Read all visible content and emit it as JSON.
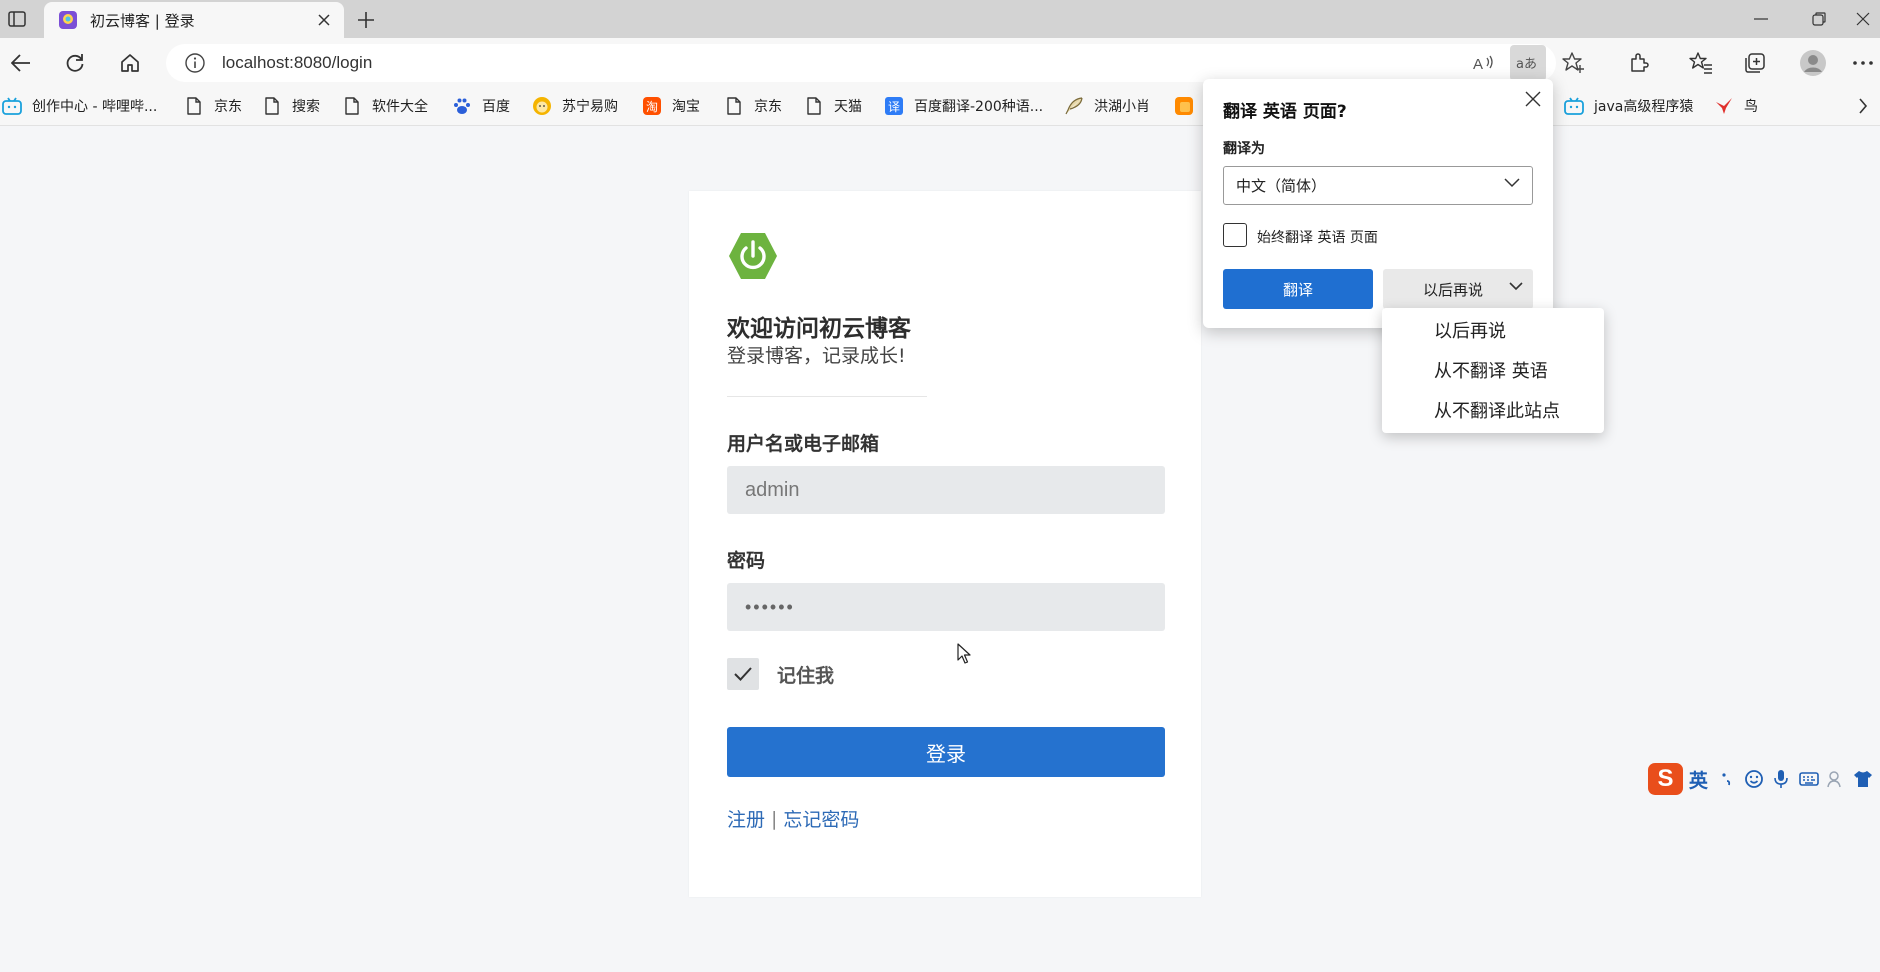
{
  "browser": {
    "tab_title": "初云博客 | 登录",
    "url": "localhost:8080/login",
    "favorites": [
      {
        "label": "创作中心 - 哔哩哔...",
        "icon": "bilibili-icon"
      },
      {
        "label": "京东",
        "icon": "page-icon"
      },
      {
        "label": "搜索",
        "icon": "page-icon"
      },
      {
        "label": "软件大全",
        "icon": "page-icon"
      },
      {
        "label": "百度",
        "icon": "baidu-paw-icon"
      },
      {
        "label": "苏宁易购",
        "icon": "suning-lion-icon"
      },
      {
        "label": "淘宝",
        "icon": "taobao-icon"
      },
      {
        "label": "京东",
        "icon": "page-icon"
      },
      {
        "label": "天猫",
        "icon": "page-icon"
      },
      {
        "label": "百度翻译-200种语...",
        "icon": "baidu-translate-icon"
      },
      {
        "label": "洪湖小肖",
        "icon": "feather-icon"
      },
      {
        "label": "java高级程序猿",
        "icon": "bilibili-icon"
      },
      {
        "label": "鸟",
        "icon": "bird-icon"
      }
    ]
  },
  "login": {
    "heading": "欢迎访问初云博客",
    "subheading": "登录博客，记录成长!",
    "username_label": "用户名或电子邮箱",
    "username_value": "admin",
    "password_label": "密码",
    "password_value": "••••••",
    "remember_label": "记住我",
    "remember_checked": true,
    "submit_label": "登录",
    "register_link": "注册",
    "link_separator": "|",
    "forgot_link": "忘记密码"
  },
  "translate_popup": {
    "title": "翻译 英语 页面?",
    "target_label": "翻译为",
    "target_value": "中文（简体）",
    "always_label": "始终翻译 英语 页面",
    "always_checked": false,
    "translate_button": "翻译",
    "later_button": "以后再说",
    "menu_items": [
      "以后再说",
      "从不翻译 英语",
      "从不翻译此站点"
    ]
  },
  "ime": {
    "mode": "英",
    "logo": "S"
  },
  "colors": {
    "primary_button": "#2572cf",
    "popup_primary": "#1f6fd1",
    "link": "#2d6ab6",
    "spring_green": "#6db33f"
  }
}
